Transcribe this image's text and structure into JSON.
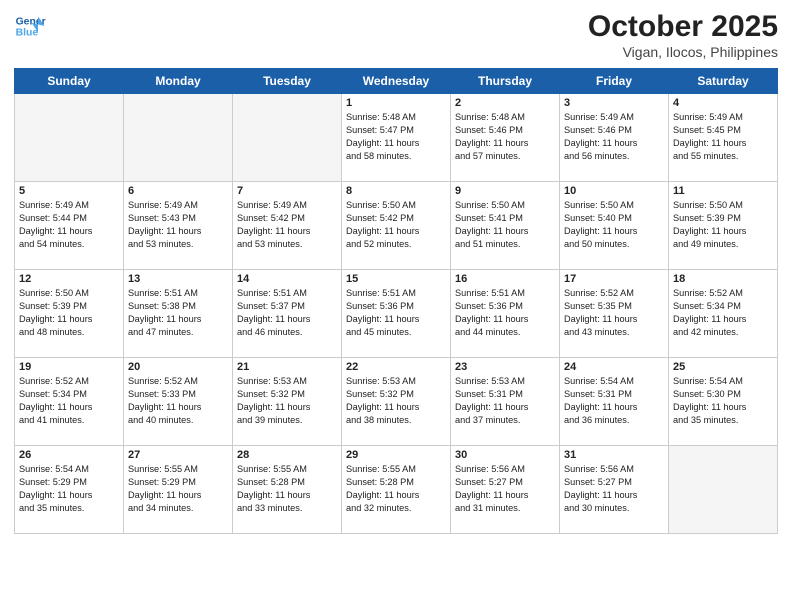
{
  "header": {
    "logo_line1": "General",
    "logo_line2": "Blue",
    "month_title": "October 2025",
    "subtitle": "Vigan, Ilocos, Philippines"
  },
  "weekdays": [
    "Sunday",
    "Monday",
    "Tuesday",
    "Wednesday",
    "Thursday",
    "Friday",
    "Saturday"
  ],
  "weeks": [
    [
      {
        "day": "",
        "content": ""
      },
      {
        "day": "",
        "content": ""
      },
      {
        "day": "",
        "content": ""
      },
      {
        "day": "1",
        "content": "Sunrise: 5:48 AM\nSunset: 5:47 PM\nDaylight: 11 hours\nand 58 minutes."
      },
      {
        "day": "2",
        "content": "Sunrise: 5:48 AM\nSunset: 5:46 PM\nDaylight: 11 hours\nand 57 minutes."
      },
      {
        "day": "3",
        "content": "Sunrise: 5:49 AM\nSunset: 5:46 PM\nDaylight: 11 hours\nand 56 minutes."
      },
      {
        "day": "4",
        "content": "Sunrise: 5:49 AM\nSunset: 5:45 PM\nDaylight: 11 hours\nand 55 minutes."
      }
    ],
    [
      {
        "day": "5",
        "content": "Sunrise: 5:49 AM\nSunset: 5:44 PM\nDaylight: 11 hours\nand 54 minutes."
      },
      {
        "day": "6",
        "content": "Sunrise: 5:49 AM\nSunset: 5:43 PM\nDaylight: 11 hours\nand 53 minutes."
      },
      {
        "day": "7",
        "content": "Sunrise: 5:49 AM\nSunset: 5:42 PM\nDaylight: 11 hours\nand 53 minutes."
      },
      {
        "day": "8",
        "content": "Sunrise: 5:50 AM\nSunset: 5:42 PM\nDaylight: 11 hours\nand 52 minutes."
      },
      {
        "day": "9",
        "content": "Sunrise: 5:50 AM\nSunset: 5:41 PM\nDaylight: 11 hours\nand 51 minutes."
      },
      {
        "day": "10",
        "content": "Sunrise: 5:50 AM\nSunset: 5:40 PM\nDaylight: 11 hours\nand 50 minutes."
      },
      {
        "day": "11",
        "content": "Sunrise: 5:50 AM\nSunset: 5:39 PM\nDaylight: 11 hours\nand 49 minutes."
      }
    ],
    [
      {
        "day": "12",
        "content": "Sunrise: 5:50 AM\nSunset: 5:39 PM\nDaylight: 11 hours\nand 48 minutes."
      },
      {
        "day": "13",
        "content": "Sunrise: 5:51 AM\nSunset: 5:38 PM\nDaylight: 11 hours\nand 47 minutes."
      },
      {
        "day": "14",
        "content": "Sunrise: 5:51 AM\nSunset: 5:37 PM\nDaylight: 11 hours\nand 46 minutes."
      },
      {
        "day": "15",
        "content": "Sunrise: 5:51 AM\nSunset: 5:36 PM\nDaylight: 11 hours\nand 45 minutes."
      },
      {
        "day": "16",
        "content": "Sunrise: 5:51 AM\nSunset: 5:36 PM\nDaylight: 11 hours\nand 44 minutes."
      },
      {
        "day": "17",
        "content": "Sunrise: 5:52 AM\nSunset: 5:35 PM\nDaylight: 11 hours\nand 43 minutes."
      },
      {
        "day": "18",
        "content": "Sunrise: 5:52 AM\nSunset: 5:34 PM\nDaylight: 11 hours\nand 42 minutes."
      }
    ],
    [
      {
        "day": "19",
        "content": "Sunrise: 5:52 AM\nSunset: 5:34 PM\nDaylight: 11 hours\nand 41 minutes."
      },
      {
        "day": "20",
        "content": "Sunrise: 5:52 AM\nSunset: 5:33 PM\nDaylight: 11 hours\nand 40 minutes."
      },
      {
        "day": "21",
        "content": "Sunrise: 5:53 AM\nSunset: 5:32 PM\nDaylight: 11 hours\nand 39 minutes."
      },
      {
        "day": "22",
        "content": "Sunrise: 5:53 AM\nSunset: 5:32 PM\nDaylight: 11 hours\nand 38 minutes."
      },
      {
        "day": "23",
        "content": "Sunrise: 5:53 AM\nSunset: 5:31 PM\nDaylight: 11 hours\nand 37 minutes."
      },
      {
        "day": "24",
        "content": "Sunrise: 5:54 AM\nSunset: 5:31 PM\nDaylight: 11 hours\nand 36 minutes."
      },
      {
        "day": "25",
        "content": "Sunrise: 5:54 AM\nSunset: 5:30 PM\nDaylight: 11 hours\nand 35 minutes."
      }
    ],
    [
      {
        "day": "26",
        "content": "Sunrise: 5:54 AM\nSunset: 5:29 PM\nDaylight: 11 hours\nand 35 minutes."
      },
      {
        "day": "27",
        "content": "Sunrise: 5:55 AM\nSunset: 5:29 PM\nDaylight: 11 hours\nand 34 minutes."
      },
      {
        "day": "28",
        "content": "Sunrise: 5:55 AM\nSunset: 5:28 PM\nDaylight: 11 hours\nand 33 minutes."
      },
      {
        "day": "29",
        "content": "Sunrise: 5:55 AM\nSunset: 5:28 PM\nDaylight: 11 hours\nand 32 minutes."
      },
      {
        "day": "30",
        "content": "Sunrise: 5:56 AM\nSunset: 5:27 PM\nDaylight: 11 hours\nand 31 minutes."
      },
      {
        "day": "31",
        "content": "Sunrise: 5:56 AM\nSunset: 5:27 PM\nDaylight: 11 hours\nand 30 minutes."
      },
      {
        "day": "",
        "content": ""
      }
    ]
  ]
}
